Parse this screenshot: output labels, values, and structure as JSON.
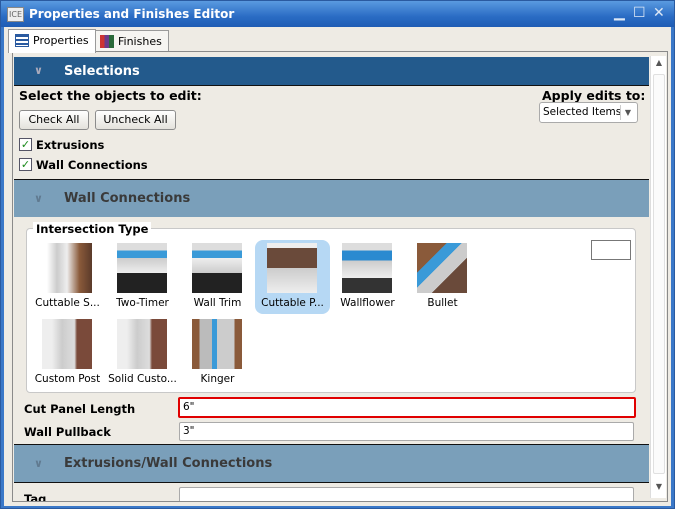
{
  "window": {
    "title": "Properties and Finishes Editor",
    "app_icon": "ICE"
  },
  "tabs": [
    {
      "label": "Properties",
      "icon": "list-icon",
      "active": true
    },
    {
      "label": "Finishes",
      "icon": "color-grid-icon",
      "active": false
    }
  ],
  "selections": {
    "header": "Selections",
    "prompt": "Select the objects to edit:",
    "check_all": "Check All",
    "uncheck_all": "Uncheck All",
    "apply_label": "Apply edits to:",
    "apply_value": "Selected Items",
    "checkboxes": [
      {
        "label": "Extrusions",
        "checked": true
      },
      {
        "label": "Wall Connections",
        "checked": true
      }
    ]
  },
  "wall_connections": {
    "header": "Wall Connections",
    "group_title": "Intersection Type",
    "types": [
      {
        "label": "Cuttable S...",
        "selected": false
      },
      {
        "label": "Two-Timer",
        "selected": false
      },
      {
        "label": "Wall Trim",
        "selected": false
      },
      {
        "label": "Cuttable P...",
        "selected": true
      },
      {
        "label": "Wallflower",
        "selected": false
      },
      {
        "label": "Bullet",
        "selected": false
      },
      {
        "label": "Custom Post",
        "selected": false
      },
      {
        "label": "Solid Custo...",
        "selected": false
      },
      {
        "label": "Kinger",
        "selected": false
      }
    ],
    "fields": [
      {
        "label": "Cut Panel Length",
        "value": "6\""
      },
      {
        "label": "Wall Pullback",
        "value": "3\""
      }
    ]
  },
  "extrusions_wall": {
    "header": "Extrusions/Wall Connections",
    "fields": [
      {
        "label": "Tag",
        "value": ""
      }
    ]
  },
  "colors": {
    "selections_header": "#235a8c",
    "section_header": "#7a9fba",
    "highlight": "#e00000",
    "selected_tile": "#b6d8f4"
  }
}
